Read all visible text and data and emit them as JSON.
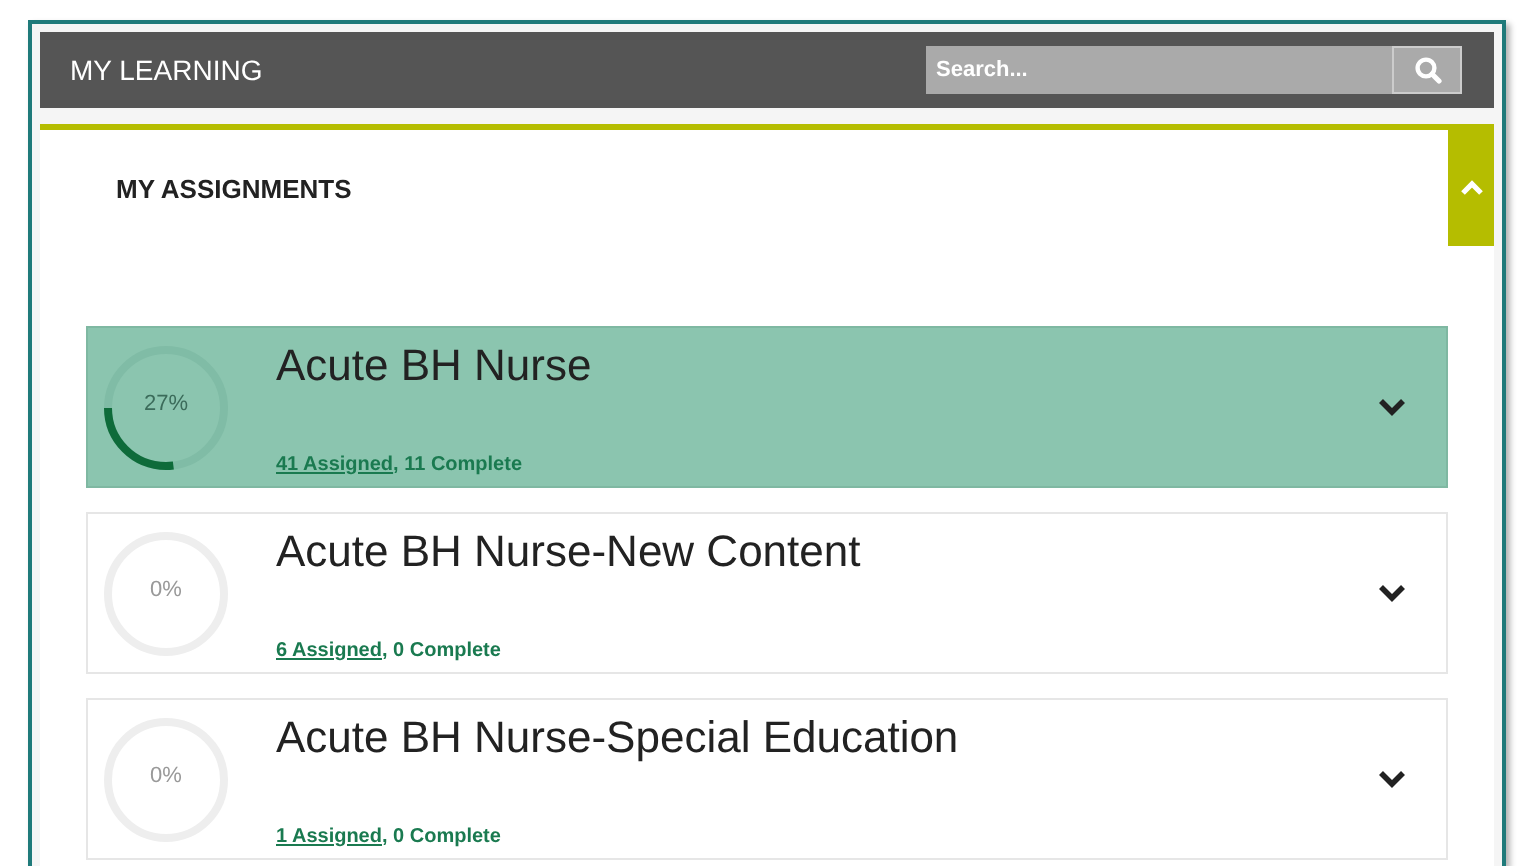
{
  "header": {
    "title": "MY LEARNING",
    "search": {
      "placeholder": "Search..."
    }
  },
  "section": {
    "title": "MY ASSIGNMENTS",
    "expanded": true
  },
  "assignments": [
    {
      "name": "Acute BH Nurse",
      "percent": "27%",
      "level": 0.27,
      "assigned": "41 Assigned",
      "complete": ", 11 Complete",
      "selected": true
    },
    {
      "name": "Acute BH Nurse-New Content",
      "percent": "0%",
      "level": 0,
      "assigned": "6 Assigned",
      "complete": ", 0 Complete",
      "selected": false
    },
    {
      "name": "Acute BH Nurse-Special Education",
      "percent": "0%",
      "level": 0,
      "assigned": "1 Assigned",
      "complete": ", 0 Complete",
      "selected": false
    }
  ]
}
